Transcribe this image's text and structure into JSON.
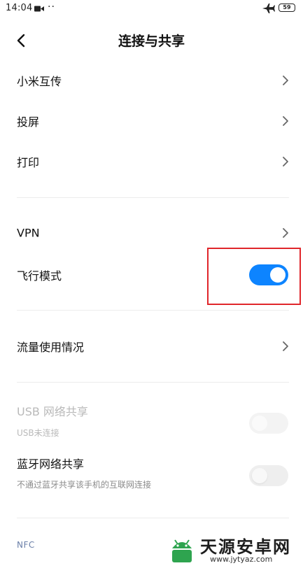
{
  "status_bar": {
    "time": "14:04",
    "dots": "··",
    "battery": "59"
  },
  "header": {
    "title": "连接与共享"
  },
  "items": {
    "xiaomi_share": "小米互传",
    "screencast": "投屏",
    "print": "打印",
    "vpn": "VPN",
    "airplane_mode": "飞行模式",
    "data_usage": "流量使用情况",
    "usb_tethering": "USB 网络共享",
    "usb_tethering_sub": "USB未连接",
    "bt_tethering": "蓝牙网络共享",
    "bt_tethering_sub": "不通过蓝牙共享该手机的互联网连接"
  },
  "toggles": {
    "airplane_mode": "on",
    "usb_tethering": "disabled-off",
    "bt_tethering": "off"
  },
  "sections": {
    "nfc": "NFC"
  },
  "watermark": {
    "title": "天源安卓网",
    "url": "www.jytyaz.com"
  },
  "colors": {
    "accent": "#0d84ff",
    "highlight": "#e0262b",
    "section_header": "#6a7fa8"
  }
}
